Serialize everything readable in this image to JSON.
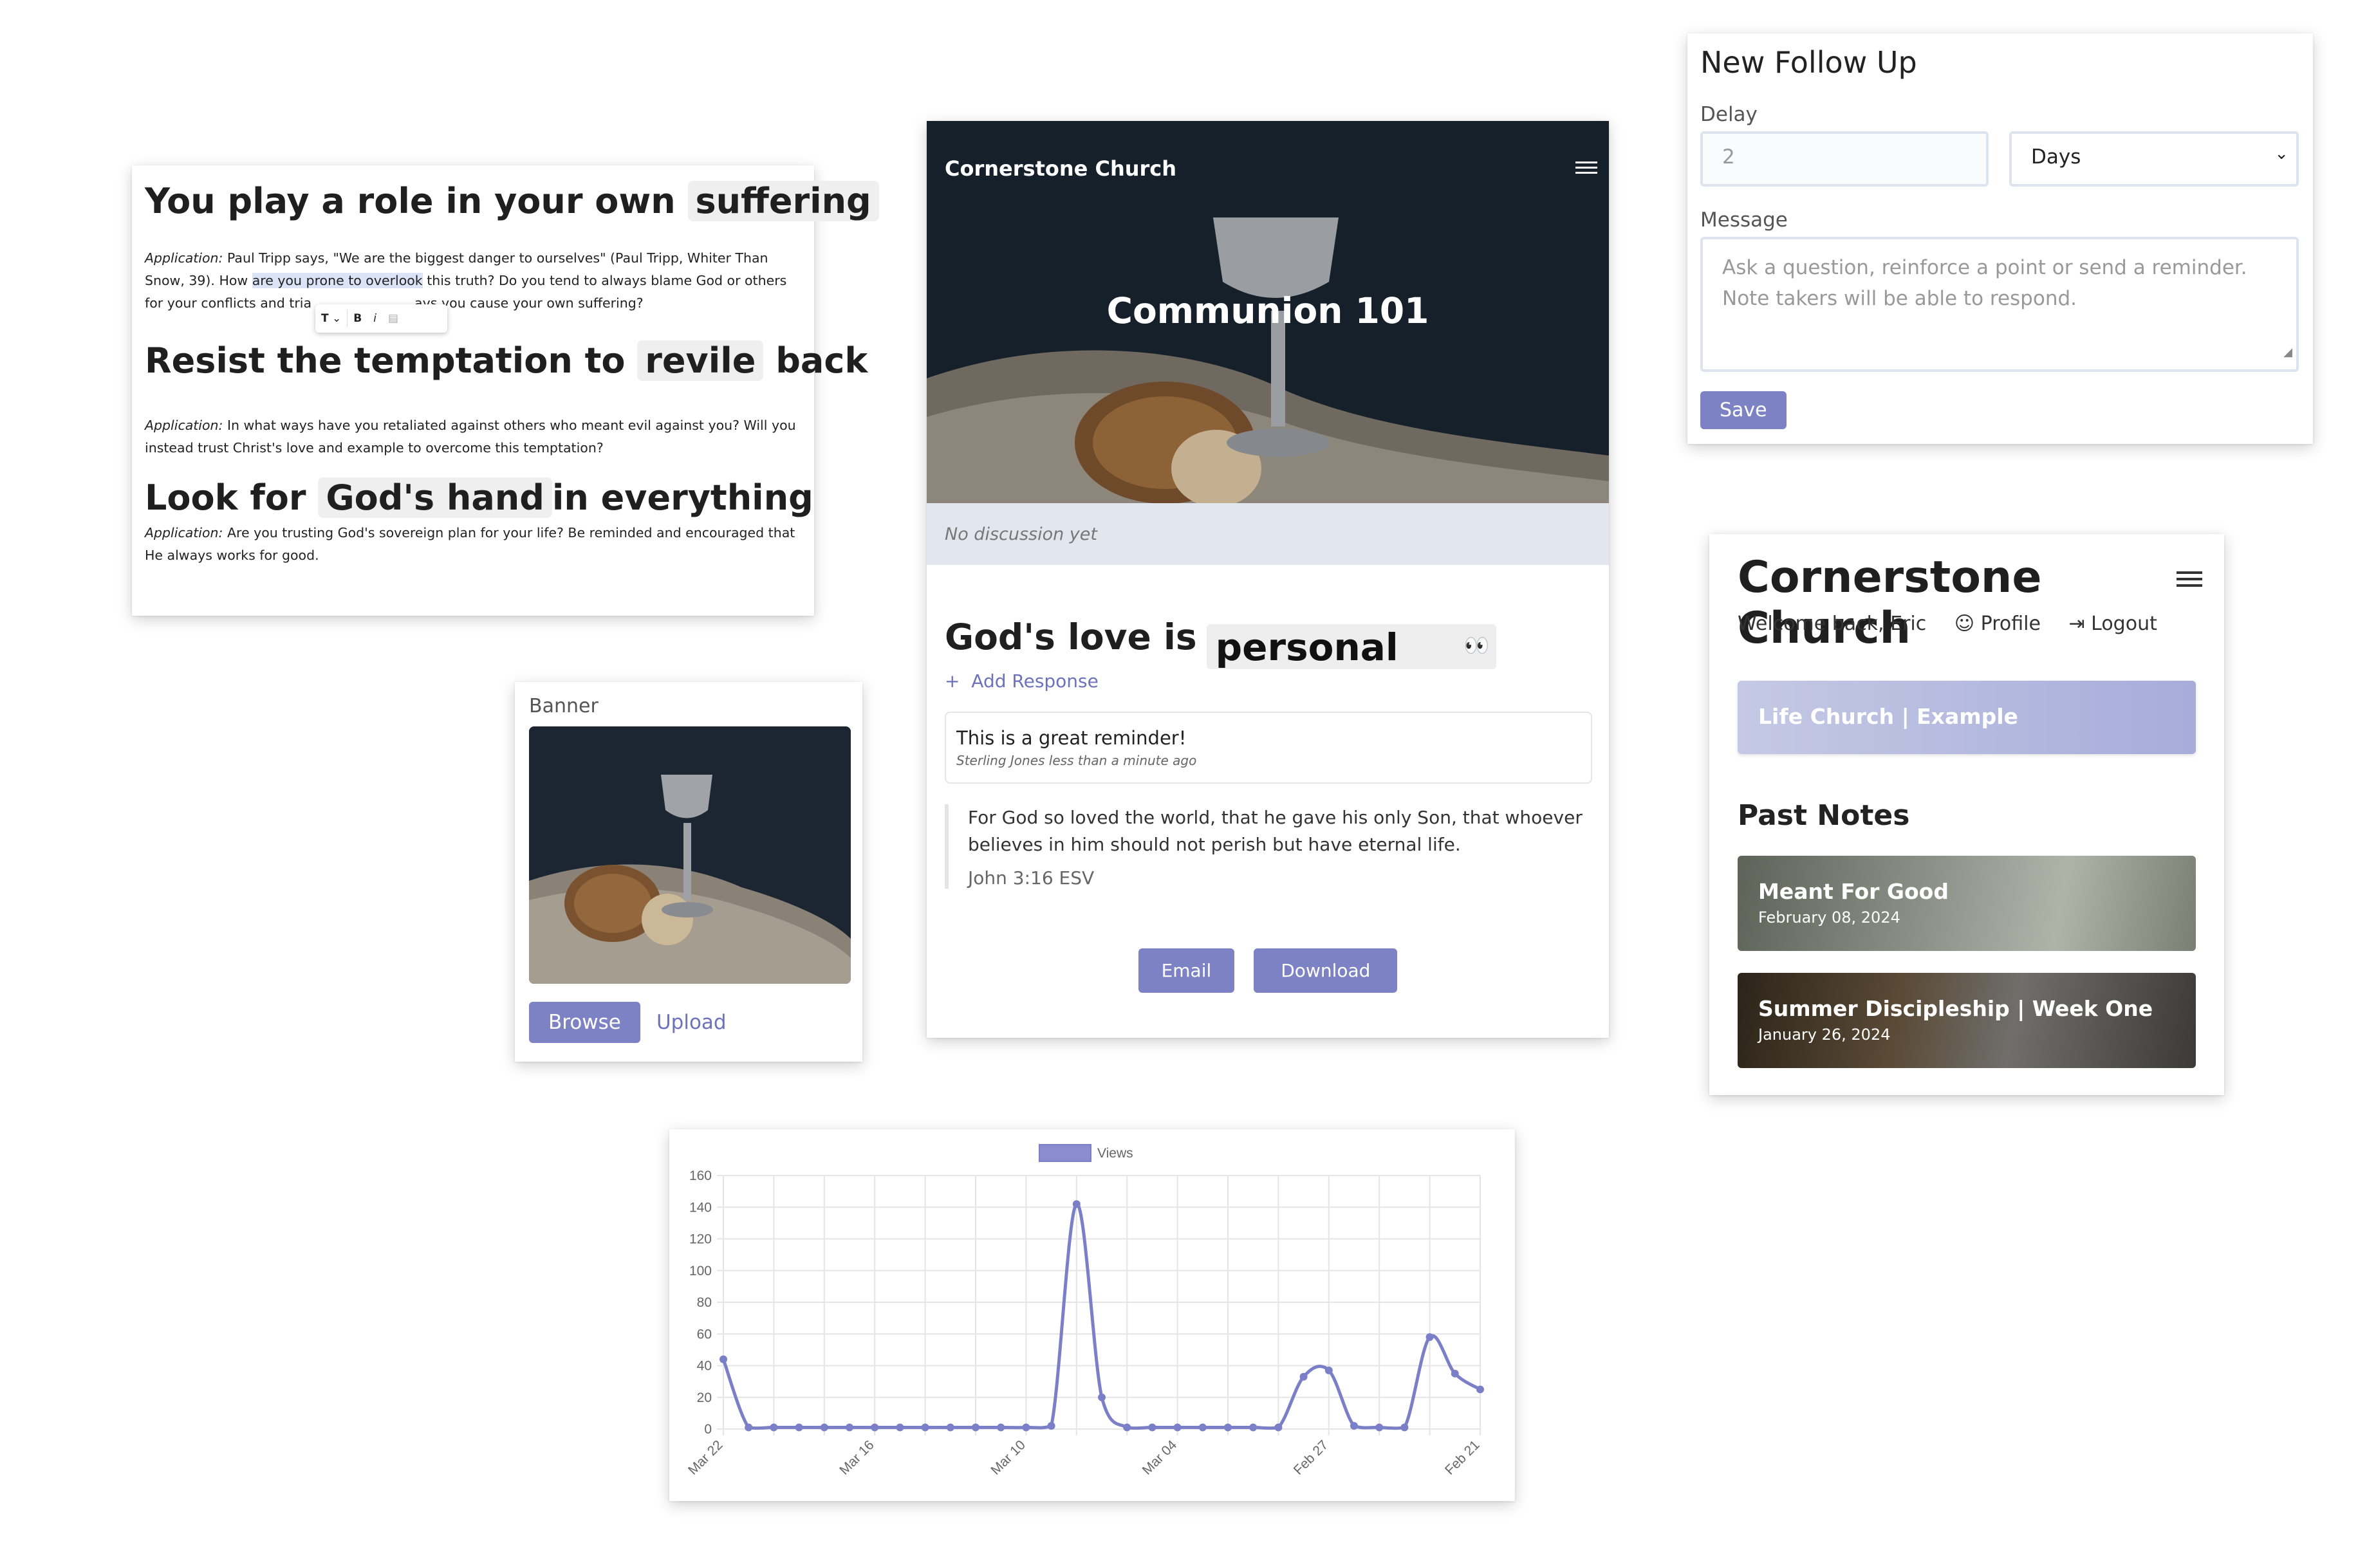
{
  "notes": {
    "heading1": {
      "before": "You play a role in your own",
      "blank": "suffering",
      "after": ""
    },
    "app1": {
      "label": "Application:",
      "text_a": " Paul Tripp says, \"We are the biggest danger to ourselves\" (Paul Tripp, Whiter Than Snow, 39). How ",
      "highlight": "are you prone to overlook",
      "text_b": " this truth? Do you tend to always blame God or others for your conflicts and tria",
      "text_c": "ays you cause your own suffering?"
    },
    "heading2": {
      "before": "Resist the temptation to",
      "blank": "revile",
      "after": "back"
    },
    "app2": {
      "label": "Application:",
      "text": " In what ways have you retaliated against others who meant evil against you? Will you instead trust Christ's love and example to overcome this temptation?"
    },
    "heading3": {
      "before": "Look for",
      "blank": "God's hand",
      "after": "in everything"
    },
    "app3": {
      "label": "Application:",
      "text": " Are you trusting God's sovereign plan for your life? Be reminded and encouraged that He always works for good."
    },
    "toolbar": {
      "text_icon": "T",
      "bold": "B",
      "italic": "i"
    }
  },
  "banner": {
    "label": "Banner",
    "browse": "Browse",
    "upload": "Upload"
  },
  "communion": {
    "brand": "Cornerstone Church",
    "title": "Communion 101",
    "discussion": "No discussion yet",
    "fill_before": "God's love is",
    "fill_value": "personal",
    "add_response": "Add Response",
    "response": {
      "text": "This is a great reminder!",
      "meta": "Sterling Jones less than a minute ago"
    },
    "verse": {
      "text": "For God so loved the world, that he gave his only Son, that whoever believes in him should not perish but have eternal life.",
      "ref": "John 3:16 ESV"
    },
    "email": "Email",
    "download": "Download"
  },
  "followup": {
    "title": "New Follow Up",
    "delay_label": "Delay",
    "delay_placeholder": "2",
    "unit": "Days",
    "message_label": "Message",
    "message_placeholder": "Ask a question, reinforce a point or send a reminder. Note takers will be able to respond.",
    "save": "Save"
  },
  "church": {
    "title": "Cornerstone Church",
    "welcome": "Welcome back, Eric",
    "profile": "Profile",
    "logout": "Logout",
    "org": "Life Church | Example",
    "past_heading": "Past Notes",
    "past": [
      {
        "title": "Meant For Good",
        "date": "February 08, 2024"
      },
      {
        "title": "Summer Discipleship | Week One",
        "date": "January 26, 2024"
      }
    ]
  },
  "chart_data": {
    "type": "line",
    "legend": "Views",
    "color": "#7b7fc7",
    "ylim": [
      0,
      160
    ],
    "yticks": [
      0,
      20,
      40,
      60,
      80,
      100,
      120,
      140,
      160
    ],
    "xtick_labels": [
      "Mar 22",
      "Mar 16",
      "Mar 10",
      "Mar 04",
      "Feb 27",
      "Feb 21"
    ],
    "series": [
      {
        "name": "Views",
        "values": [
          44,
          1,
          1,
          1,
          1,
          1,
          1,
          1,
          1,
          1,
          1,
          1,
          1,
          2,
          142,
          20,
          1,
          1,
          1,
          1,
          1,
          1,
          1,
          33,
          37,
          2,
          1,
          1,
          58,
          35,
          25
        ]
      }
    ]
  }
}
